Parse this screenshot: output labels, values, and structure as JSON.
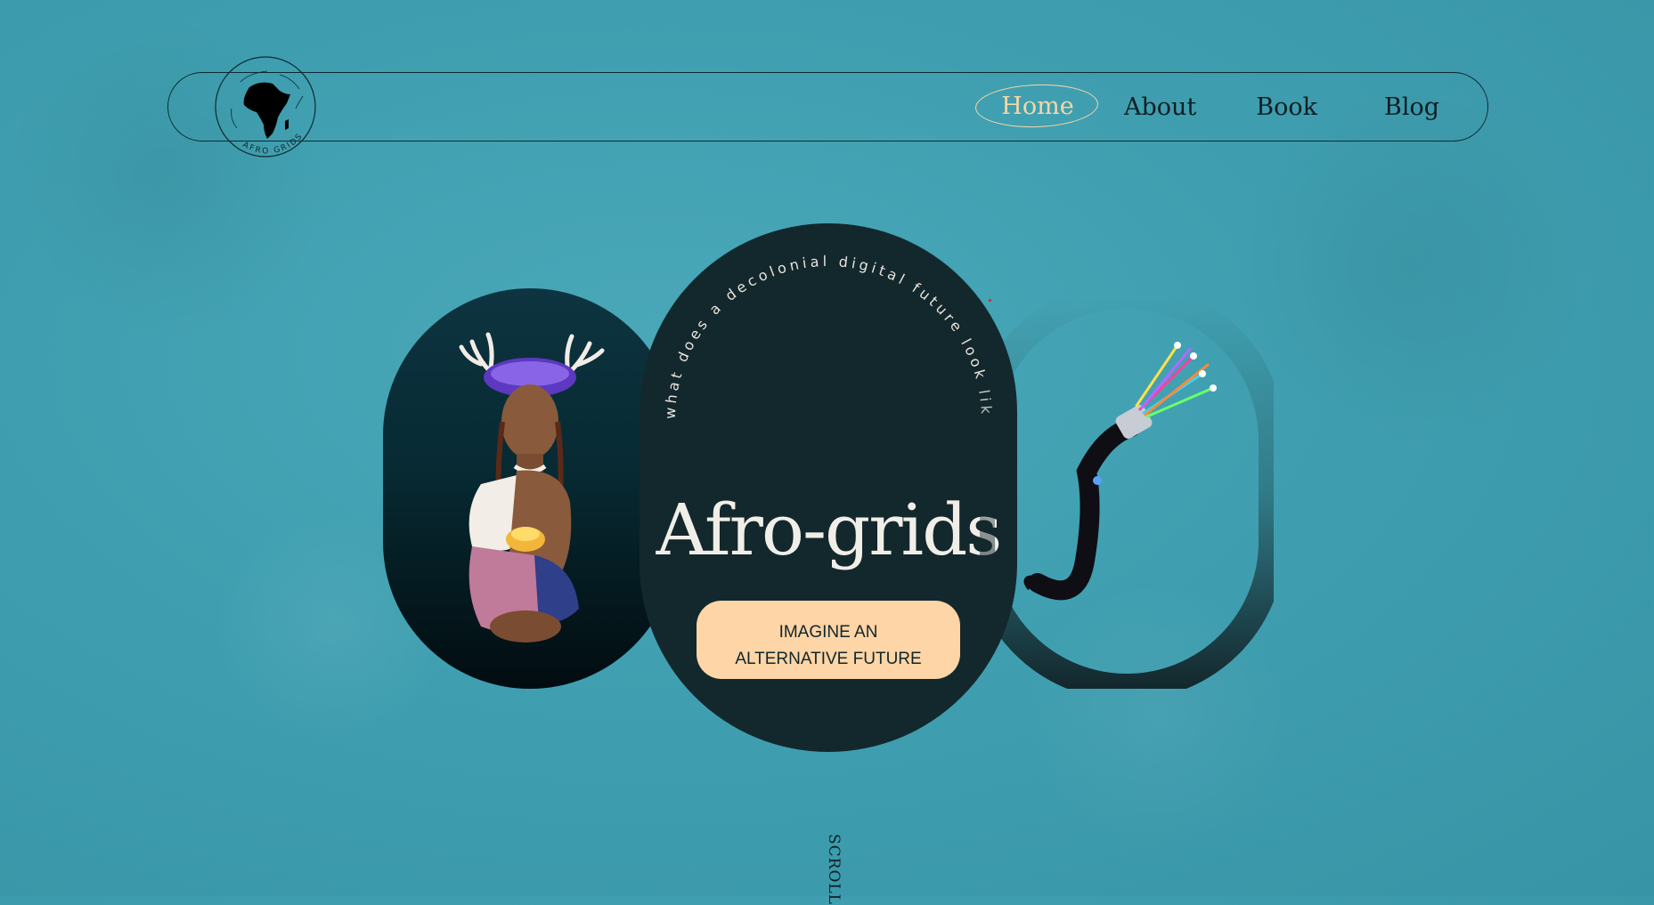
{
  "nav": {
    "logo_text": "AFRO GRIDS",
    "items": [
      {
        "label": "Home",
        "active": true
      },
      {
        "label": "About",
        "active": false
      },
      {
        "label": "Book",
        "active": false
      },
      {
        "label": "Blog",
        "active": false
      }
    ]
  },
  "hero": {
    "arc_tagline": "what  does  a  decolonial  digital  future  look  like?",
    "title": "Afro-grids",
    "cta_line1": "IMAGINE AN",
    "cta_line2": "ALTERNATIVE FUTURE"
  },
  "scroll_label": "SCROLL",
  "colors": {
    "background": "#3f9fb0",
    "pill_dark": "#13282d",
    "cta_bg": "#fdd5a6",
    "nav_active": "#f5d7a8",
    "ink": "#0f1e22"
  },
  "images": {
    "left_illustration": "woman-with-antlers-illustration",
    "right_illustration": "fiber-optic-cable-illustration"
  }
}
